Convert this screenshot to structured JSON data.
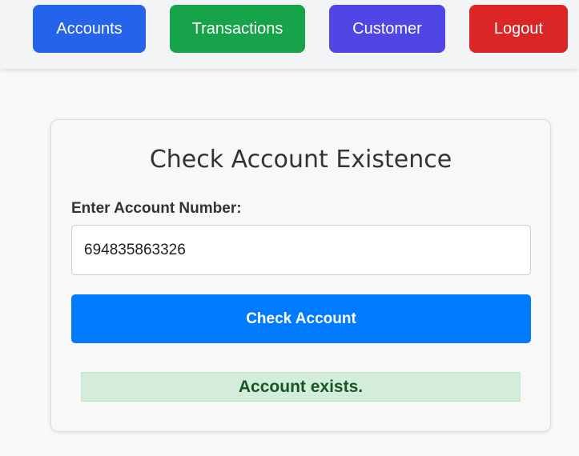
{
  "nav": {
    "accounts_label": "Accounts",
    "transactions_label": "Transactions",
    "customer_label": "Customer",
    "logout_label": "Logout"
  },
  "colors": {
    "accounts": "#2563eb",
    "transactions": "#16a34a",
    "customer": "#4f46e5",
    "logout": "#dc2626",
    "primary": "#007bff",
    "success_bg": "#d4edda",
    "success_text": "#155724"
  },
  "form": {
    "title": "Check Account Existence",
    "label": "Enter Account Number:",
    "account_value": "694835863326",
    "button_label": "Check Account"
  },
  "result": {
    "message": "Account exists."
  }
}
